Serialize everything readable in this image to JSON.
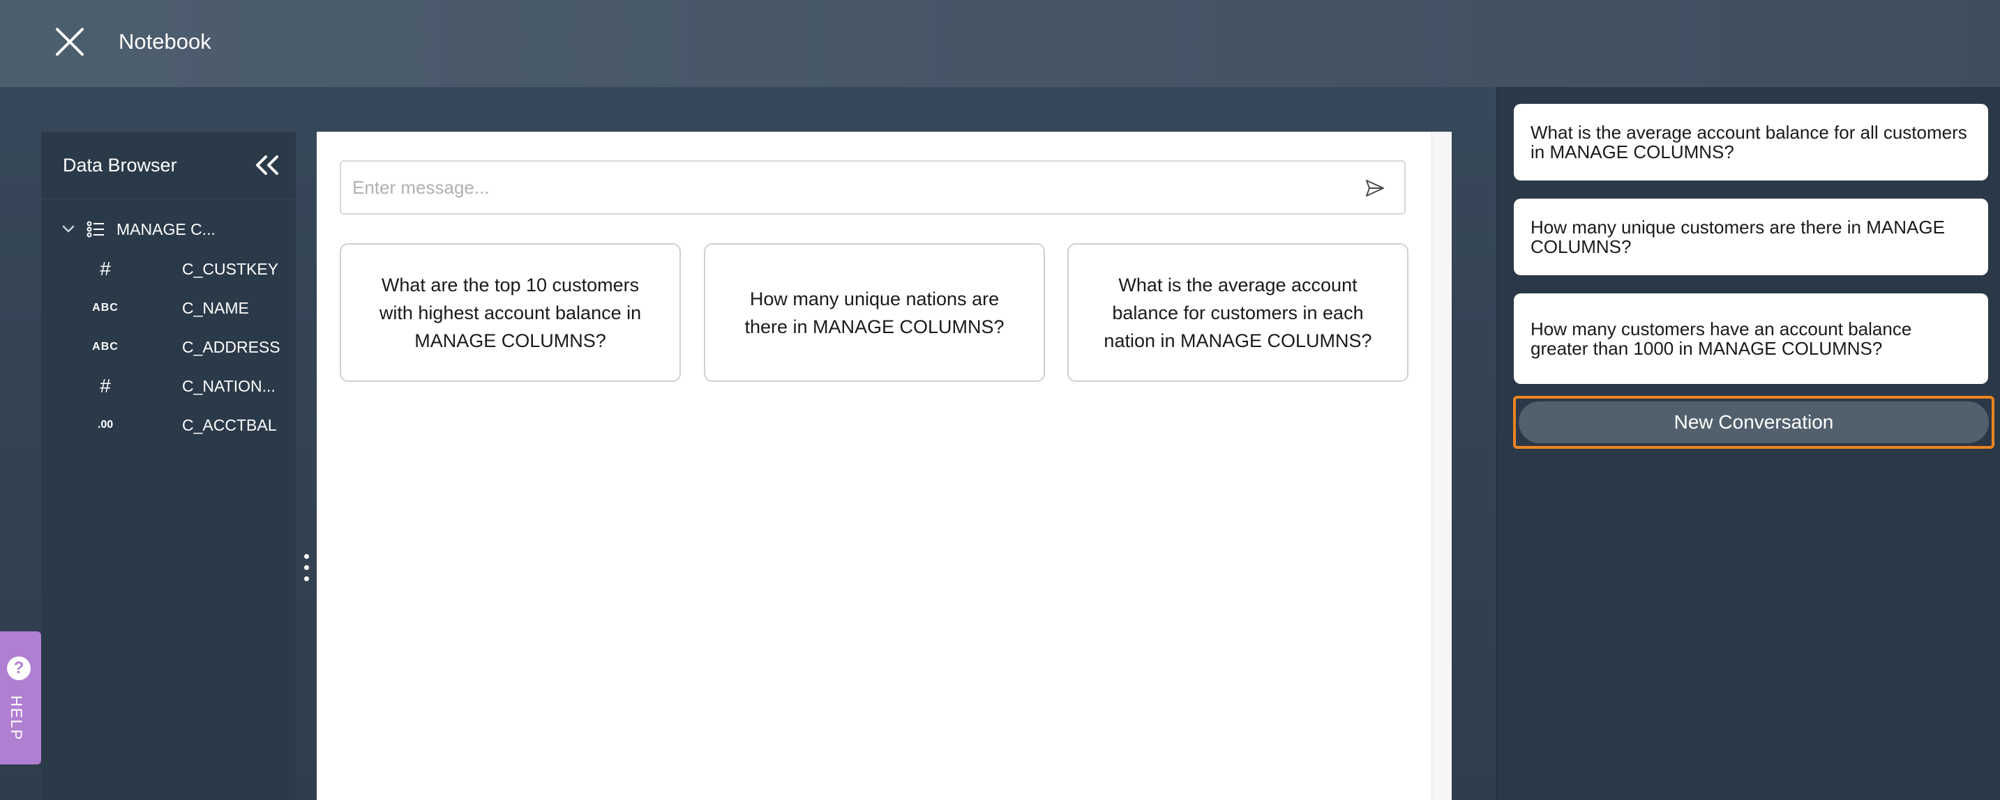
{
  "header": {
    "title": "Notebook",
    "close_icon": "close-icon"
  },
  "data_browser": {
    "title": "Data Browser",
    "table": {
      "label": "MANAGE C..."
    },
    "columns": [
      {
        "type": "#",
        "label": "C_CUSTKEY"
      },
      {
        "type": "ABC",
        "label": "C_NAME"
      },
      {
        "type": "ABC",
        "label": "C_ADDRESS"
      },
      {
        "type": "#",
        "label": "C_NATION..."
      },
      {
        "type": ".00",
        "label": "C_ACCTBAL"
      }
    ]
  },
  "help": {
    "label": "HELP"
  },
  "chat": {
    "placeholder": "Enter message...",
    "suggestions": [
      "What are the top 10 customers with highest account balance in MANAGE COLUMNS?",
      "How many unique nations are there in MANAGE COLUMNS?",
      "What is the average account balance for customers in each nation in MANAGE COLUMNS?"
    ]
  },
  "sidebar": {
    "questions": [
      "What is the average account balance for all customers in MANAGE COLUMNS?",
      "How many unique customers are there in MANAGE COLUMNS?",
      "How many customers have an account balance greater than 1000 in MANAGE COLUMNS?"
    ],
    "new_conversation": "New Conversation"
  },
  "colors": {
    "highlight": "#f0841f",
    "help": "#b07fd1",
    "panel_bg": "#2b3847"
  }
}
